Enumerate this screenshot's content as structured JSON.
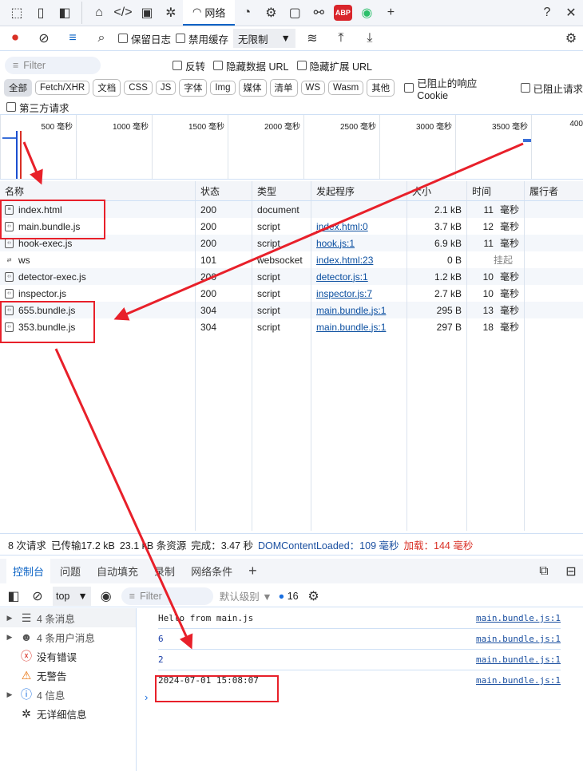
{
  "tabbar": {
    "active_tab": "网络",
    "abp": "ABP"
  },
  "toolbar": {
    "preserve_log": "保留日志",
    "disable_cache": "禁用缓存",
    "throttle": "无限制"
  },
  "filter": {
    "placeholder": "Filter",
    "invert": "反转",
    "hide_data_url": "隐藏数据 URL",
    "hide_ext_url": "隐藏扩展 URL"
  },
  "types": [
    "全部",
    "Fetch/XHR",
    "文档",
    "CSS",
    "JS",
    "字体",
    "Img",
    "媒体",
    "清单",
    "WS",
    "Wasm",
    "其他"
  ],
  "blocked_cookie": "已阻止的响应 Cookie",
  "blocked_requests": "已阻止请求",
  "third_party": "第三方请求",
  "timeline": {
    "ticks": [
      "500 毫秒",
      "1000 毫秒",
      "1500 毫秒",
      "2000 毫秒",
      "2500 毫秒",
      "3000 毫秒",
      "3500 毫秒",
      "400"
    ]
  },
  "table": {
    "headers": [
      "名称",
      "状态",
      "类型",
      "发起程序",
      "大小",
      "时间",
      "履行者"
    ],
    "rows": [
      {
        "icon": "document-icon",
        "name": "index.html",
        "status": "200",
        "type": "document",
        "initiator": "",
        "size": "2.1 kB",
        "time": "11",
        "unit": "毫秒"
      },
      {
        "icon": "script-icon",
        "name": "main.bundle.js",
        "status": "200",
        "type": "script",
        "initiator": "index.html:0",
        "size": "3.7 kB",
        "time": "12",
        "unit": "毫秒"
      },
      {
        "icon": "script-icon",
        "name": "hook-exec.js",
        "status": "200",
        "type": "script",
        "initiator": "hook.js:1",
        "size": "6.9 kB",
        "time": "11",
        "unit": "毫秒"
      },
      {
        "icon": "websocket-icon",
        "name": "ws",
        "status": "101",
        "type": "websocket",
        "initiator": "index.html:23",
        "size": "0 B",
        "time": "挂起",
        "unit": ""
      },
      {
        "icon": "script-icon",
        "name": "detector-exec.js",
        "status": "200",
        "type": "script",
        "initiator": "detector.js:1",
        "size": "1.2 kB",
        "time": "10",
        "unit": "毫秒"
      },
      {
        "icon": "script-icon",
        "name": "inspector.js",
        "status": "200",
        "type": "script",
        "initiator": "inspector.js:7",
        "size": "2.7 kB",
        "time": "10",
        "unit": "毫秒"
      },
      {
        "icon": "script-icon",
        "name": "655.bundle.js",
        "status": "304",
        "type": "script",
        "initiator": "main.bundle.js:1",
        "size": "295 B",
        "time": "13",
        "unit": "毫秒"
      },
      {
        "icon": "script-icon",
        "name": "353.bundle.js",
        "status": "304",
        "type": "script",
        "initiator": "main.bundle.js:1",
        "size": "297 B",
        "time": "18",
        "unit": "毫秒"
      }
    ]
  },
  "summary": {
    "requests": "8 次请求",
    "transferred": "已传输17.2 kB",
    "resources": "23.1 kB 条资源",
    "finish": "完成：3.47 秒",
    "dcl": "DOMContentLoaded：109 毫秒",
    "load": "加载：144 毫秒"
  },
  "drawer": {
    "tabs": [
      "控制台",
      "问题",
      "自动填充",
      "录制",
      "网络条件"
    ]
  },
  "console": {
    "context": "top",
    "filter_placeholder": "Filter",
    "level": "默认级别",
    "issues_count": "16",
    "sidebar": [
      "4 条消息",
      "4 条用户消息",
      "没有错误",
      "无警告",
      "4 信息",
      "无详细信息"
    ],
    "logs": [
      {
        "text": "Hello from main.js",
        "src": "main.bundle.js:1"
      },
      {
        "text": "6",
        "src": "main.bundle.js:1"
      },
      {
        "text": "2",
        "src": "main.bundle.js:1"
      },
      {
        "text": "2024-07-01 15:08:07",
        "src": "main.bundle.js:1"
      }
    ]
  },
  "colors": {
    "accent": "#0b63c5",
    "annotation": "#e8202a",
    "record": "#d93025"
  }
}
